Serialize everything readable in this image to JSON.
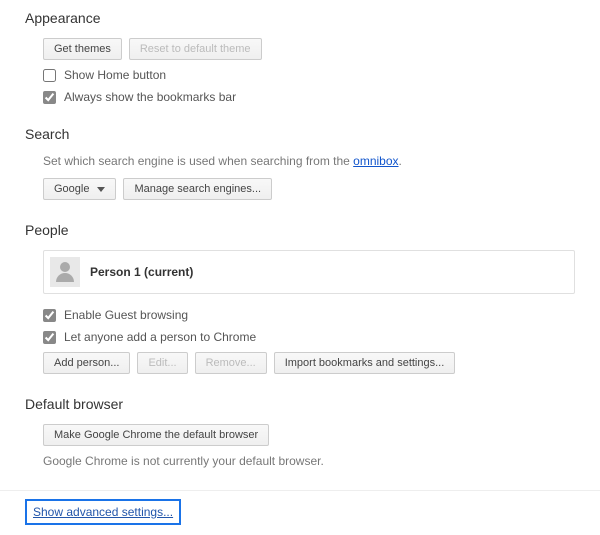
{
  "appearance": {
    "title": "Appearance",
    "get_themes": "Get themes",
    "reset_theme": "Reset to default theme",
    "show_home": "Show Home button",
    "always_bookmarks": "Always show the bookmarks bar"
  },
  "search": {
    "title": "Search",
    "desc_prefix": "Set which search engine is used when searching from the ",
    "omnibox": "omnibox",
    "desc_suffix": ".",
    "engine": "Google",
    "manage": "Manage search engines..."
  },
  "people": {
    "title": "People",
    "person_name": "Person 1 (current)",
    "enable_guest": "Enable Guest browsing",
    "let_anyone": "Let anyone add a person to Chrome",
    "add_person": "Add person...",
    "edit": "Edit...",
    "remove": "Remove...",
    "import": "Import bookmarks and settings..."
  },
  "default_browser": {
    "title": "Default browser",
    "make_default": "Make Google Chrome the default browser",
    "status": "Google Chrome is not currently your default browser."
  },
  "advanced": "Show advanced settings..."
}
